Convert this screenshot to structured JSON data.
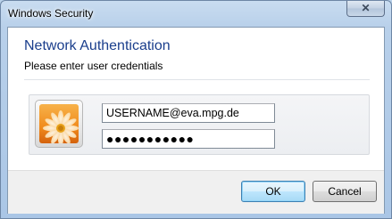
{
  "window": {
    "title": "Windows Security",
    "close_label": "✕"
  },
  "dialog": {
    "heading": "Network Authentication",
    "subheading": "Please enter user credentials"
  },
  "credentials": {
    "username_value": "USERNAME@eva.mpg.de",
    "password_value": "●●●●●●●●●●●",
    "avatar_icon": "flower-user-tile-icon"
  },
  "buttons": {
    "ok_label": "OK",
    "cancel_label": "Cancel"
  },
  "colors": {
    "heading": "#1a3e8c",
    "ok_button_accent": "#3c7fb1",
    "frame": "#b8d0ea"
  }
}
